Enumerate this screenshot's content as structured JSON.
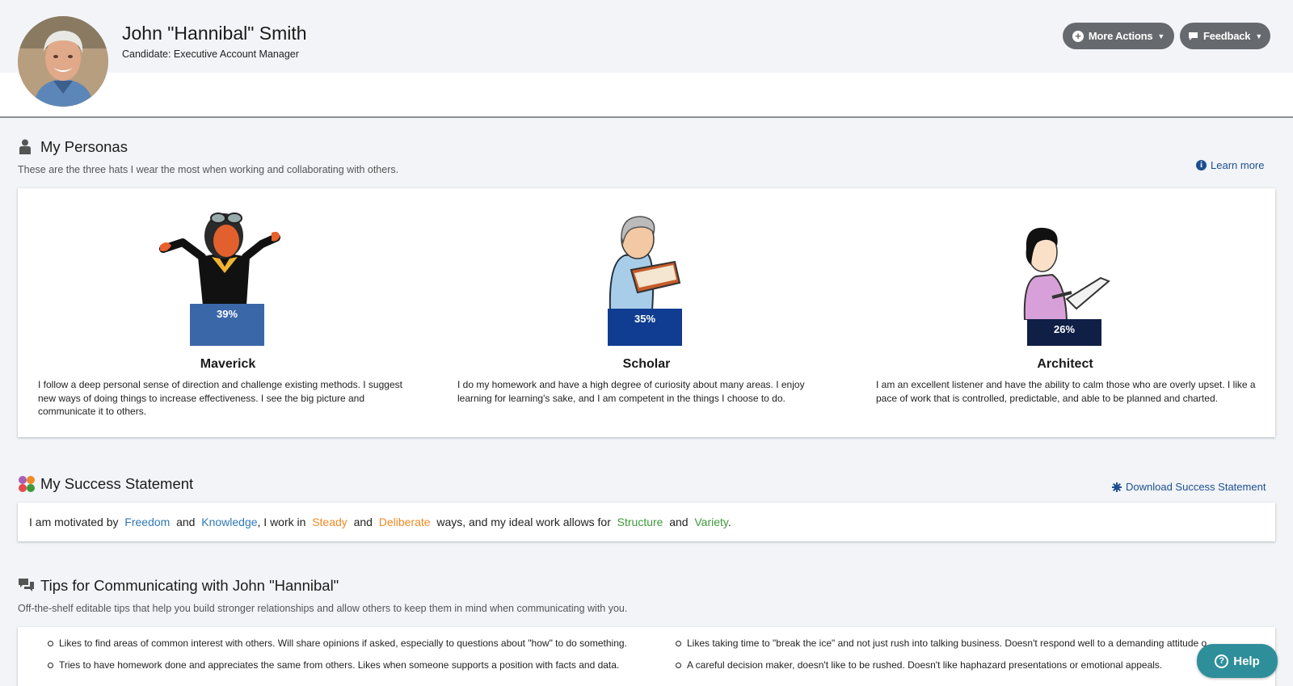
{
  "header": {
    "name": "John \"Hannibal\" Smith",
    "candidate": "Candidate: Executive Account Manager",
    "more_actions_label": "More Actions",
    "feedback_label": "Feedback"
  },
  "personas": {
    "title": "My Personas",
    "subtitle": "These are the three hats I wear the most when working and collaborating with others.",
    "learn_more": "Learn more",
    "items": [
      {
        "name": "Maverick",
        "percent": "39%",
        "color": "#3a67a8",
        "description": "I follow a deep personal sense of direction and challenge existing methods. I suggest new ways of doing things to increase effectiveness. I see the big picture and communicate it to others."
      },
      {
        "name": "Scholar",
        "percent": "35%",
        "color": "#103d91",
        "description": "I do my homework and have a high degree of curiosity about many areas. I enjoy learning for learning's sake, and I am competent in the things I choose to do."
      },
      {
        "name": "Architect",
        "percent": "26%",
        "color": "#0f1f46",
        "description": "I am an excellent listener and have the ability to calm those who are overly upset. I like a pace of work that is controlled, predictable, and able to be planned and charted."
      }
    ]
  },
  "success": {
    "title": "My Success Statement",
    "download": "Download Success Statement",
    "text1": "I am motivated by",
    "kw1": "Freedom",
    "and1": "and",
    "kw2": "Knowledge",
    "text2": ", I work in",
    "kw3": "Steady",
    "and2": "and",
    "kw4": "Deliberate",
    "text3": "ways, and my ideal work allows for",
    "kw5": "Structure",
    "and3": "and",
    "kw6": "Variety",
    "period": "."
  },
  "tips": {
    "title": "Tips for Communicating with John \"Hannibal\"",
    "subtitle": "Off-the-shelf editable tips that help you build stronger relationships and allow others to keep them in mind when communicating with you.",
    "left": [
      "Likes to find areas of common interest with others. Will share opinions if asked, especially to questions about \"how\" to do something.",
      "Tries to have homework done and appreciates the same from others. Likes when someone supports a position with facts and data."
    ],
    "right": [
      "Likes taking time to \"break the ice\" and not just rush into talking business. Doesn't respond well to a demanding attitude or d",
      "A careful decision maker, doesn't like to be rushed. Doesn't like haphazard presentations or emotional appeals."
    ]
  },
  "help_label": "Help"
}
